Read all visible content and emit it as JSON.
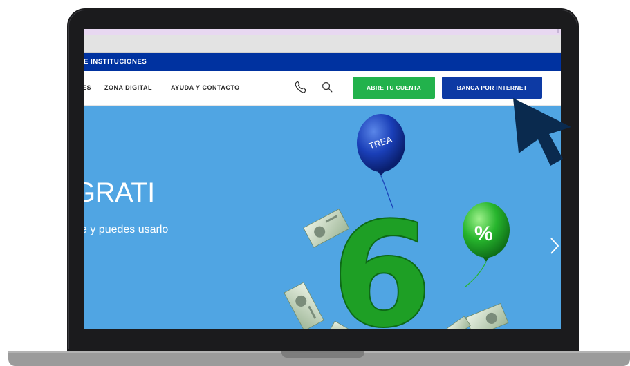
{
  "institutions_bar": {
    "label": "E INSTITUCIONES"
  },
  "nav": {
    "items": [
      {
        "label": "ES"
      },
      {
        "label": "ZONA DIGITAL"
      },
      {
        "label": "AYUDA Y CONTACTO"
      }
    ],
    "phone_icon": "phone-icon",
    "search_icon": "search-icon",
    "open_account_label": "ABRE TU CUENTA",
    "online_banking_label": "BANCA POR INTERNET"
  },
  "hero": {
    "title": "GRATI",
    "subtitle": "ce y puedes usarlo",
    "balloon_label": "TREA",
    "big_number": "6",
    "percent_symbol": "%",
    "next_icon": "chevron-right-icon"
  },
  "colors": {
    "brand_blue": "#0032a0",
    "button_green": "#22b24c",
    "button_blue": "#0d3aa4",
    "hero_background": "#50a5e3",
    "cursor": "#0a2a4e"
  }
}
